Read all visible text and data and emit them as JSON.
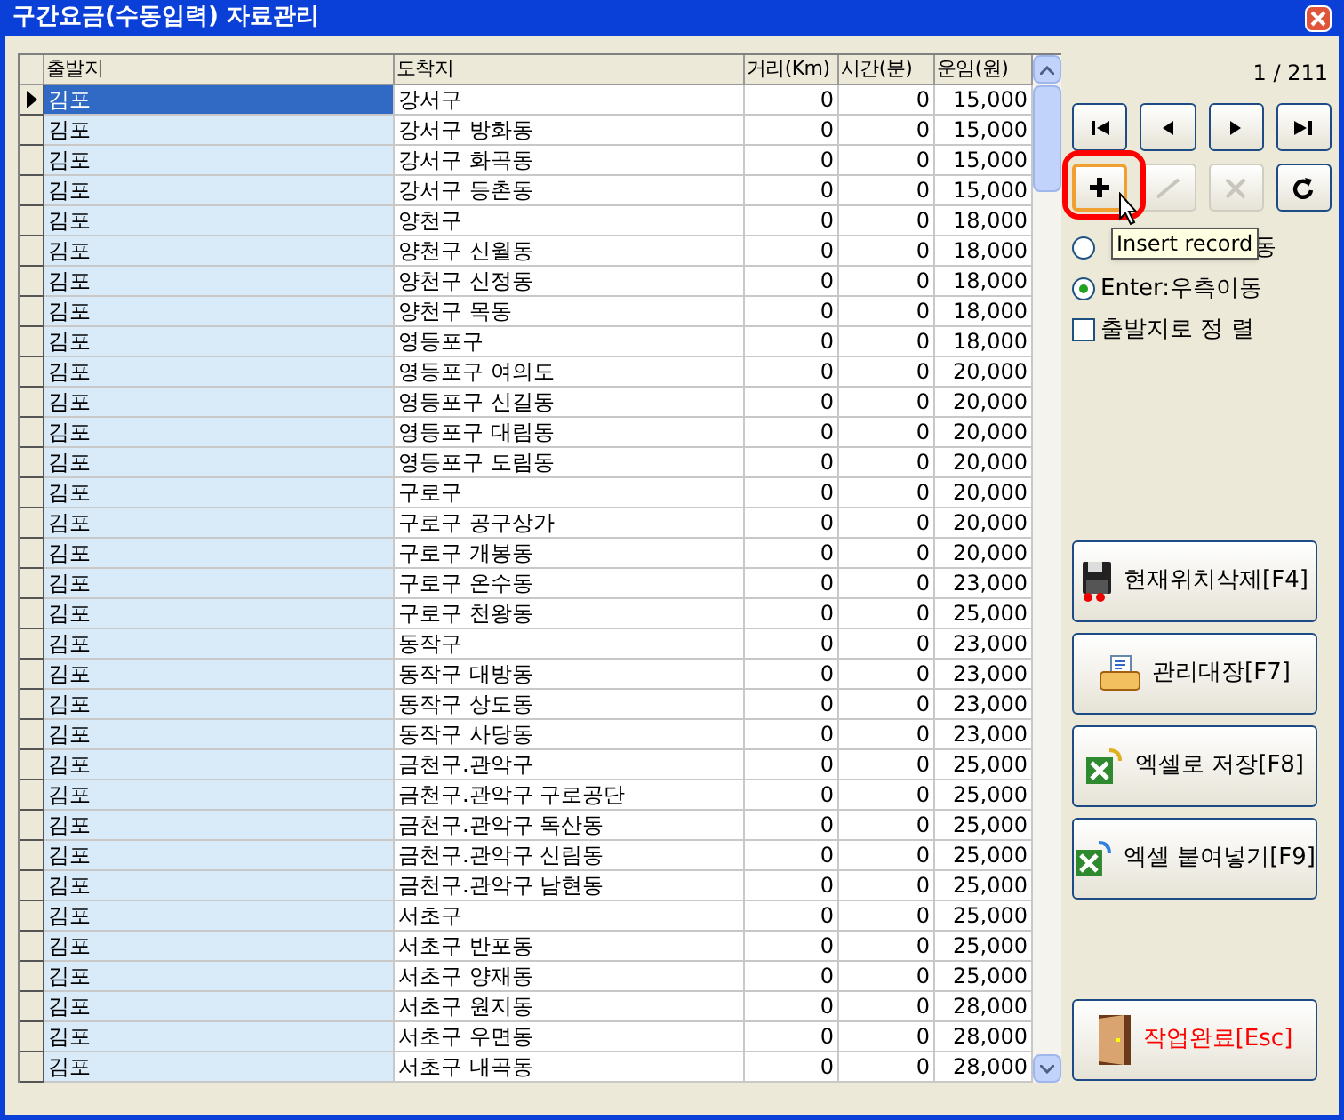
{
  "window": {
    "title": "구간요금(수동입력) 자료관리"
  },
  "table": {
    "columns": [
      "출발지",
      "도착지",
      "거리(Km)",
      "시간(분)",
      "운임(원)"
    ],
    "rows": [
      {
        "cells": [
          "김포",
          "강서구",
          "0",
          "0",
          "15,000"
        ],
        "selected": true
      },
      {
        "cells": [
          "김포",
          "강서구 방화동",
          "0",
          "0",
          "15,000"
        ],
        "selected": false
      },
      {
        "cells": [
          "김포",
          "강서구 화곡동",
          "0",
          "0",
          "15,000"
        ],
        "selected": false
      },
      {
        "cells": [
          "김포",
          "강서구 등촌동",
          "0",
          "0",
          "15,000"
        ],
        "selected": false
      },
      {
        "cells": [
          "김포",
          "양천구",
          "0",
          "0",
          "18,000"
        ],
        "selected": false
      },
      {
        "cells": [
          "김포",
          "양천구 신월동",
          "0",
          "0",
          "18,000"
        ],
        "selected": false
      },
      {
        "cells": [
          "김포",
          "양천구 신정동",
          "0",
          "0",
          "18,000"
        ],
        "selected": false
      },
      {
        "cells": [
          "김포",
          "양천구 목동",
          "0",
          "0",
          "18,000"
        ],
        "selected": false
      },
      {
        "cells": [
          "김포",
          "영등포구",
          "0",
          "0",
          "18,000"
        ],
        "selected": false
      },
      {
        "cells": [
          "김포",
          "영등포구 여의도",
          "0",
          "0",
          "20,000"
        ],
        "selected": false
      },
      {
        "cells": [
          "김포",
          "영등포구 신길동",
          "0",
          "0",
          "20,000"
        ],
        "selected": false
      },
      {
        "cells": [
          "김포",
          "영등포구 대림동",
          "0",
          "0",
          "20,000"
        ],
        "selected": false
      },
      {
        "cells": [
          "김포",
          "영등포구 도림동",
          "0",
          "0",
          "20,000"
        ],
        "selected": false
      },
      {
        "cells": [
          "김포",
          "구로구",
          "0",
          "0",
          "20,000"
        ],
        "selected": false
      },
      {
        "cells": [
          "김포",
          "구로구 공구상가",
          "0",
          "0",
          "20,000"
        ],
        "selected": false
      },
      {
        "cells": [
          "김포",
          "구로구 개봉동",
          "0",
          "0",
          "20,000"
        ],
        "selected": false
      },
      {
        "cells": [
          "김포",
          "구로구 온수동",
          "0",
          "0",
          "23,000"
        ],
        "selected": false
      },
      {
        "cells": [
          "김포",
          "구로구 천왕동",
          "0",
          "0",
          "25,000"
        ],
        "selected": false
      },
      {
        "cells": [
          "김포",
          "동작구",
          "0",
          "0",
          "23,000"
        ],
        "selected": false
      },
      {
        "cells": [
          "김포",
          "동작구 대방동",
          "0",
          "0",
          "23,000"
        ],
        "selected": false
      },
      {
        "cells": [
          "김포",
          "동작구 상도동",
          "0",
          "0",
          "23,000"
        ],
        "selected": false
      },
      {
        "cells": [
          "김포",
          "동작구 사당동",
          "0",
          "0",
          "23,000"
        ],
        "selected": false
      },
      {
        "cells": [
          "김포",
          "금천구.관악구",
          "0",
          "0",
          "25,000"
        ],
        "selected": false
      },
      {
        "cells": [
          "김포",
          "금천구.관악구 구로공단",
          "0",
          "0",
          "25,000"
        ],
        "selected": false
      },
      {
        "cells": [
          "김포",
          "금천구.관악구 독산동",
          "0",
          "0",
          "25,000"
        ],
        "selected": false
      },
      {
        "cells": [
          "김포",
          "금천구.관악구 신림동",
          "0",
          "0",
          "25,000"
        ],
        "selected": false
      },
      {
        "cells": [
          "김포",
          "금천구.관악구 남현동",
          "0",
          "0",
          "25,000"
        ],
        "selected": false
      },
      {
        "cells": [
          "김포",
          "서초구",
          "0",
          "0",
          "25,000"
        ],
        "selected": false
      },
      {
        "cells": [
          "김포",
          "서초구 반포동",
          "0",
          "0",
          "25,000"
        ],
        "selected": false
      },
      {
        "cells": [
          "김포",
          "서초구 양재동",
          "0",
          "0",
          "25,000"
        ],
        "selected": false
      },
      {
        "cells": [
          "김포",
          "서초구 원지동",
          "0",
          "0",
          "28,000"
        ],
        "selected": false
      },
      {
        "cells": [
          "김포",
          "서초구 우면동",
          "0",
          "0",
          "28,000"
        ],
        "selected": false
      },
      {
        "cells": [
          "김포",
          "서초구 내곡동",
          "0",
          "0",
          "28,000"
        ],
        "selected": false
      }
    ]
  },
  "record_counter": "1 / 211",
  "navigator": [
    {
      "kind": "first",
      "disabled": false,
      "focused": false
    },
    {
      "kind": "prior",
      "disabled": false,
      "focused": false
    },
    {
      "kind": "next",
      "disabled": false,
      "focused": false
    },
    {
      "kind": "last",
      "disabled": false,
      "focused": false
    },
    {
      "kind": "insert",
      "disabled": false,
      "focused": true
    },
    {
      "kind": "post",
      "disabled": true,
      "focused": false
    },
    {
      "kind": "cancel",
      "disabled": true,
      "focused": false
    },
    {
      "kind": "refresh",
      "disabled": false,
      "focused": false
    }
  ],
  "tooltip": "Insert record",
  "options": [
    {
      "kind": "radio",
      "label": "동",
      "selected": false
    },
    {
      "kind": "radio",
      "label": "Enter:우측이동",
      "selected": true
    },
    {
      "kind": "checkbox",
      "label": "출발지로 정 렬",
      "checked": false
    }
  ],
  "actions": [
    {
      "kind": "delete",
      "label": "현재위치삭제[F4]"
    },
    {
      "kind": "print",
      "label": "관리대장[F7]"
    },
    {
      "kind": "excel-save",
      "label": "엑셀로 저장[F8]"
    },
    {
      "kind": "excel-paste",
      "label": "엑셀 붙여넣기[F9]"
    },
    {
      "kind": "exit",
      "label": "작업완료[Esc]"
    }
  ]
}
